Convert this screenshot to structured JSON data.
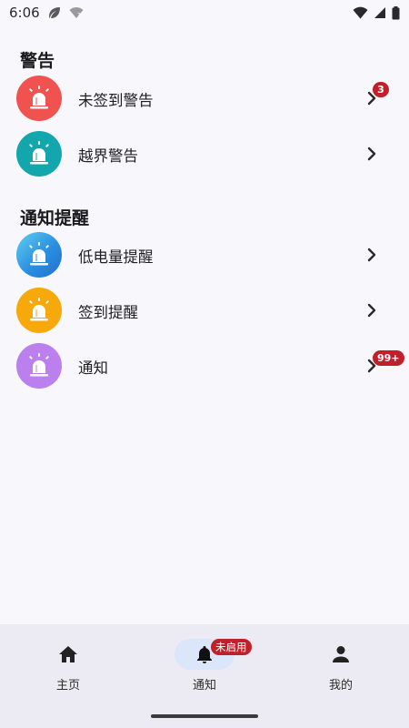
{
  "status_bar": {
    "time": "6:06",
    "icons": [
      "leaf-icon",
      "wifi-question-icon",
      "wifi-icon",
      "signal-icon",
      "battery-icon"
    ]
  },
  "sections": [
    {
      "title": "警告",
      "items": [
        {
          "label": "未签到警告",
          "color": "#f0524f",
          "icon": "siren-icon",
          "badge": "3"
        },
        {
          "label": "越界警告",
          "color": "#13a6ad",
          "icon": "siren-icon",
          "badge": null
        }
      ]
    },
    {
      "title": "通知提醒",
      "items": [
        {
          "label": "低电量提醒",
          "color": "#2b8fe0",
          "icon": "siren-icon",
          "badge": null
        },
        {
          "label": "签到提醒",
          "color": "#f7a80a",
          "icon": "siren-icon",
          "badge": null
        },
        {
          "label": "通知",
          "color": "#bb80ee",
          "icon": "siren-icon",
          "badge": "99+"
        }
      ]
    }
  ],
  "bottom_nav": {
    "items": [
      {
        "label": "主页",
        "icon": "home-icon",
        "active": false
      },
      {
        "label": "通知",
        "icon": "bell-icon",
        "active": true,
        "badge": "未启用"
      },
      {
        "label": "我的",
        "icon": "person-icon",
        "active": false
      }
    ]
  },
  "colors": {
    "background": "#f7f7fc",
    "badge": "#c0202a",
    "nav_background": "#ecebf3",
    "nav_active_pill": "#dbe6fb"
  }
}
